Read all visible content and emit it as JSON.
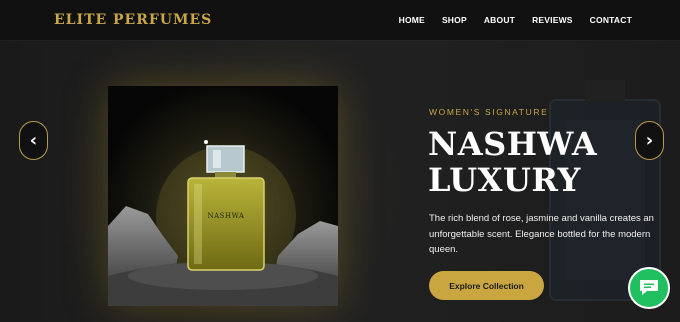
{
  "brand": {
    "name": "ELITE PERFUMES",
    "color": "#c9a646"
  },
  "nav": {
    "items": [
      {
        "label": "HOME"
      },
      {
        "label": "SHOP"
      },
      {
        "label": "ABOUT"
      },
      {
        "label": "REVIEWS"
      },
      {
        "label": "CONTACT"
      }
    ]
  },
  "hero": {
    "eyebrow": "WOMEN'S SIGNATURE",
    "title_line1": "NASHWA",
    "title_line2": "LUXURY",
    "description": "The rich blend of rose, jasmine and vanilla creates an unforgettable scent. Elegance bottled for the modern queen.",
    "cta_label": "Explore Collection",
    "product_label": "NASHWA",
    "prev_icon": "‹",
    "next_icon": "›",
    "accent": "#c9a63f"
  },
  "chat": {
    "icon": "chat-bubble-icon",
    "color": "#20c060"
  }
}
